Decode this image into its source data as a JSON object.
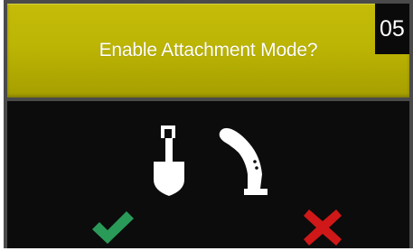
{
  "dialog": {
    "title": "Enable Attachment Mode?",
    "countdown": "05"
  },
  "icons": {
    "attachment": "shovel-icon",
    "control": "joystick-icon"
  },
  "actions": {
    "confirm": {
      "icon": "checkmark-icon",
      "color": "#2a9a58"
    },
    "cancel": {
      "icon": "x-icon",
      "color": "#d01818"
    }
  },
  "colors": {
    "header": "#bdb504",
    "background": "#0c0c0c",
    "frame": "#4a4a4a"
  }
}
